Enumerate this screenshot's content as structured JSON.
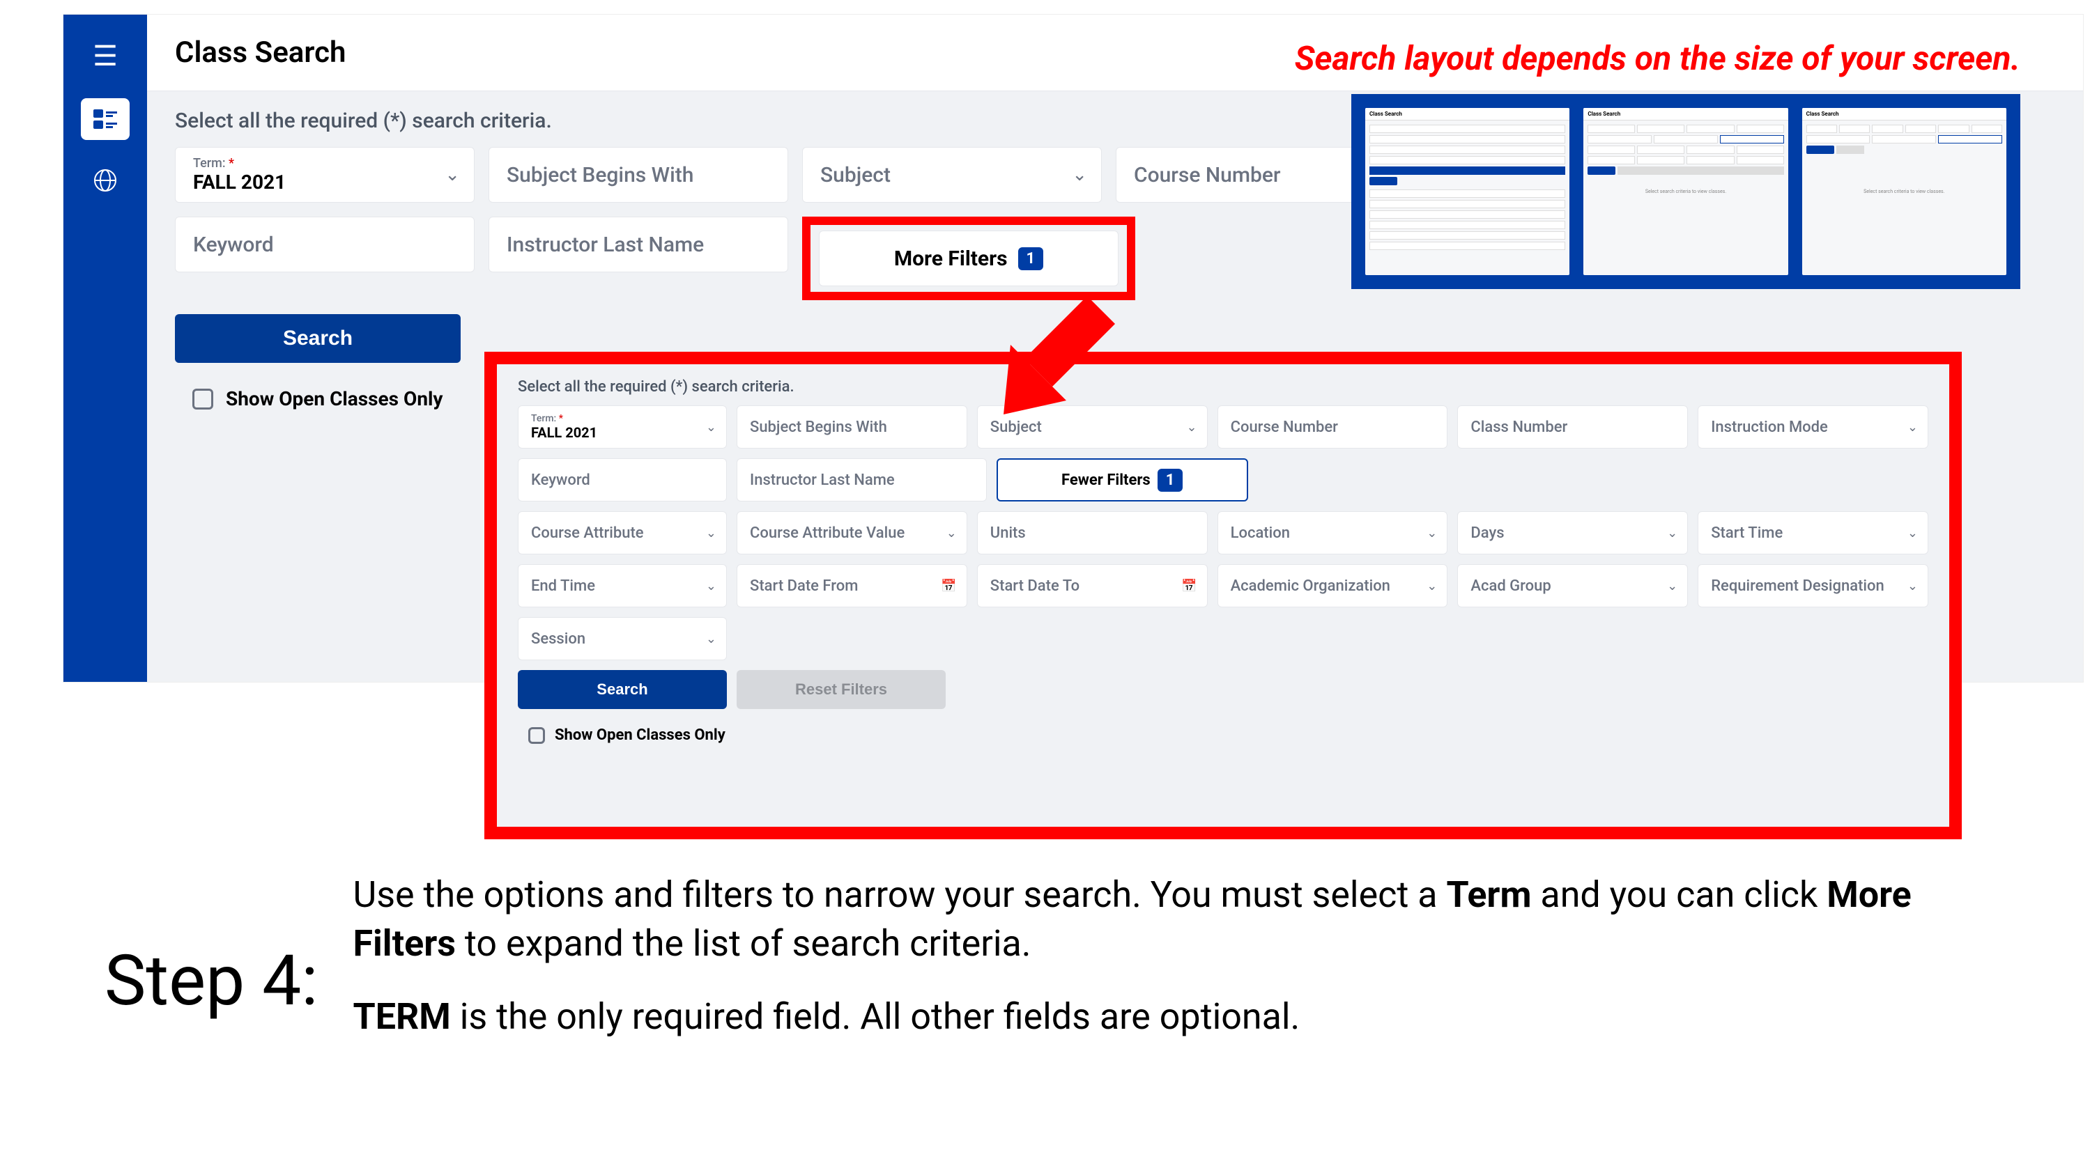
{
  "banner": "Search layout depends on the size of your screen.",
  "app": {
    "title": "Class Search",
    "criteria_label": "Select all the required (*) search criteria.",
    "term": {
      "label": "Term:",
      "required_mark": "*",
      "value": "FALL 2021"
    },
    "fields_row1": {
      "subject_begins": "Subject Begins With",
      "subject": "Subject",
      "course_number": "Course Number"
    },
    "fields_row2": {
      "keyword": "Keyword",
      "instructor": "Instructor Last Name"
    },
    "more_filters": {
      "label": "More Filters",
      "count": "1"
    },
    "search_btn": "Search",
    "show_open": "Show Open Classes Only"
  },
  "expanded": {
    "criteria_label": "Select all the required (*) search criteria.",
    "term": {
      "label": "Term:",
      "required_mark": "*",
      "value": "FALL 2021"
    },
    "row1": {
      "subject_begins": "Subject Begins With",
      "subject": "Subject",
      "course_number": "Course Number",
      "class_number": "Class Number",
      "instruction_mode": "Instruction Mode"
    },
    "row2": {
      "keyword": "Keyword",
      "instructor": "Instructor Last Name",
      "fewer_filters": "Fewer Filters",
      "fewer_count": "1"
    },
    "row3": {
      "course_attr": "Course Attribute",
      "course_attr_val": "Course Attribute Value",
      "units": "Units",
      "location": "Location",
      "days": "Days",
      "start_time": "Start Time"
    },
    "row4": {
      "end_time": "End Time",
      "start_from": "Start Date From",
      "start_to": "Start Date To",
      "acad_org": "Academic Organization",
      "acad_group": "Acad Group",
      "req_desig": "Requirement Designation"
    },
    "row5": {
      "session": "Session"
    },
    "search_btn": "Search",
    "reset_btn": "Reset Filters",
    "show_open": "Show Open Classes Only"
  },
  "thumbs": {
    "title": "Class Search",
    "msg": "Select search criteria to view classes."
  },
  "step": {
    "label": "Step 4:",
    "para1_a": "Use the options and filters to narrow your search. You must select a ",
    "para1_b": "Term",
    "para1_c": " and you can click ",
    "para1_d": "More Filters",
    "para1_e": " to expand the list of search criteria.",
    "para2_a": "TERM",
    "para2_b": " is the only required field. All other fields are optional."
  }
}
